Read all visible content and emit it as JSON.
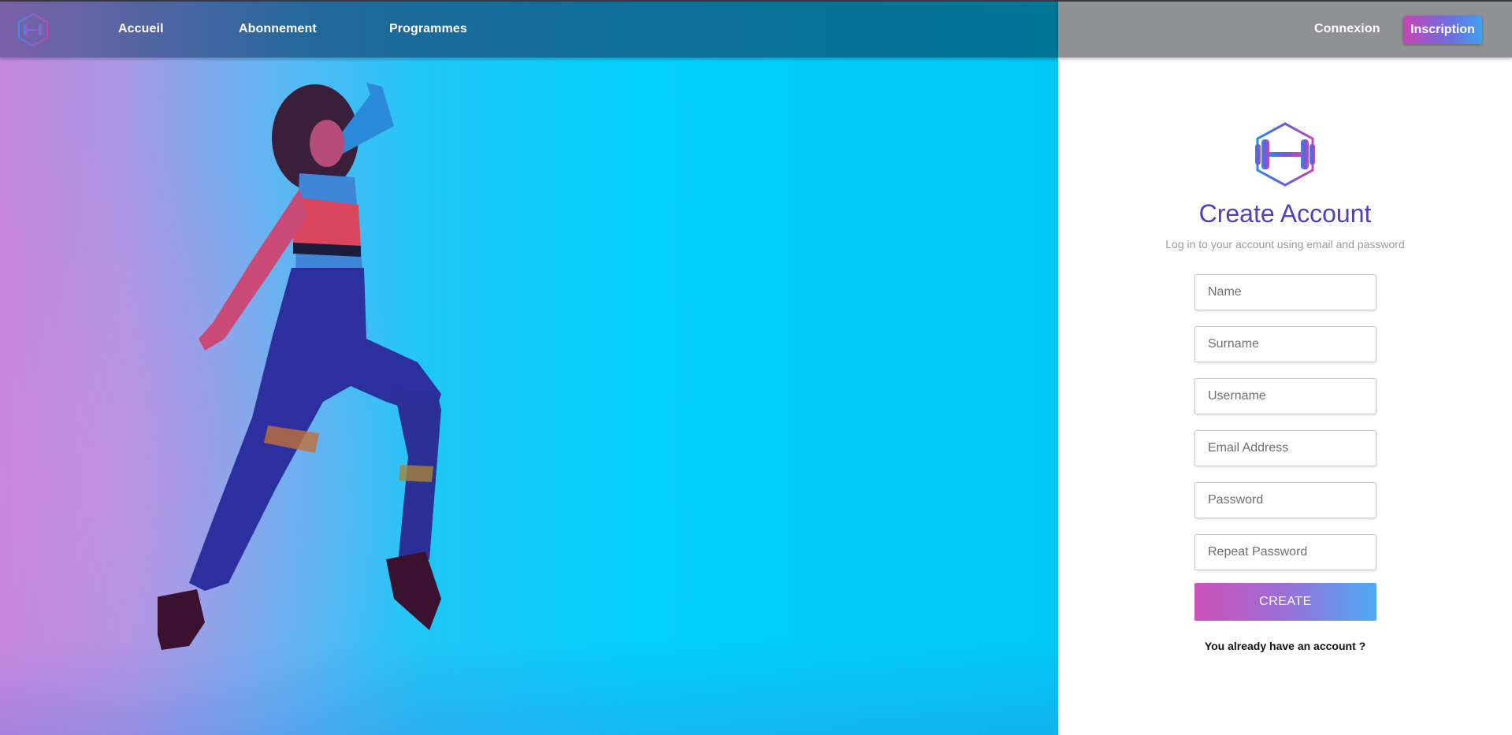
{
  "nav": {
    "links": [
      "Accueil",
      "Abonnement",
      "Programmes"
    ],
    "login_label": "Connexion",
    "signup_label": "Inscription"
  },
  "hero": {
    "image": "fitness-athlete-running-photo"
  },
  "form": {
    "logo": "dumbbell-hexagon-logo",
    "title": "Create Account",
    "subtitle": "Log in to your account using email and password",
    "fields": {
      "name": "Name",
      "surname": "Surname",
      "username": "Username",
      "email": "Email Address",
      "password": "Password",
      "repeat_password": "Repeat Password"
    },
    "submit_label": "CREATE",
    "existing_account_label": "You already have an account ?"
  },
  "colors": {
    "title": "#5340b8",
    "gradient_start": "#cd52b9",
    "gradient_end": "#4eaaf4",
    "nav_right_bg": "#8f9194"
  }
}
